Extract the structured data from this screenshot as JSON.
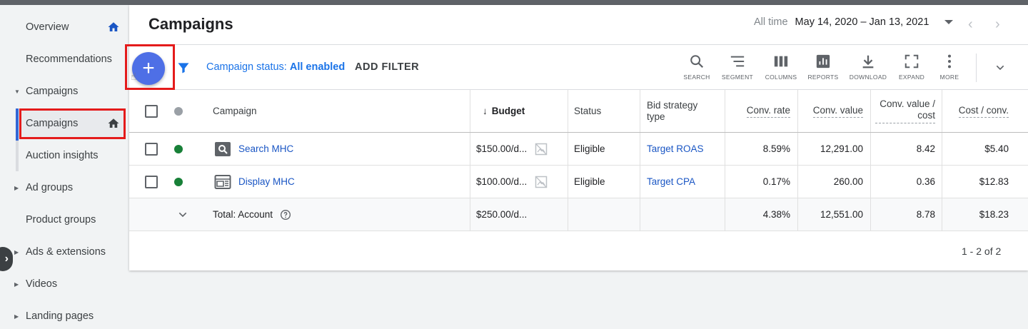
{
  "sidebar": {
    "items": [
      {
        "label": "Overview"
      },
      {
        "label": "Recommendations"
      },
      {
        "label": "Campaigns"
      },
      {
        "label": "Campaigns"
      },
      {
        "label": "Auction insights"
      },
      {
        "label": "Ad groups"
      },
      {
        "label": "Product groups"
      },
      {
        "label": "Ads & extensions"
      },
      {
        "label": "Videos"
      },
      {
        "label": "Landing pages"
      }
    ]
  },
  "header": {
    "title": "Campaigns",
    "date_prefix": "All time",
    "date_range": "May 14, 2020 – Jan 13, 2021"
  },
  "toolbar": {
    "filter_label": "Campaign status:",
    "filter_value": "All enabled",
    "add_filter": "ADD FILTER",
    "tools": [
      "SEARCH",
      "SEGMENT",
      "COLUMNS",
      "REPORTS",
      "DOWNLOAD",
      "EXPAND",
      "MORE"
    ]
  },
  "table": {
    "columns": {
      "campaign": "Campaign",
      "budget": "Budget",
      "status": "Status",
      "bid_strategy": "Bid strategy type",
      "conv_rate": "Conv. rate",
      "conv_value": "Conv. value",
      "conv_value_cost": "Conv. value / cost",
      "cost_conv": "Cost / conv."
    },
    "rows": [
      {
        "campaign": "Search MHC",
        "budget": "$150.00/d...",
        "status": "Eligible",
        "bid_strategy": "Target ROAS",
        "conv_rate": "8.59%",
        "conv_value": "12,291.00",
        "conv_value_cost": "8.42",
        "cost_conv": "$5.40"
      },
      {
        "campaign": "Display MHC",
        "budget": "$100.00/d...",
        "status": "Eligible",
        "bid_strategy": "Target CPA",
        "conv_rate": "0.17%",
        "conv_value": "260.00",
        "conv_value_cost": "0.36",
        "cost_conv": "$12.83"
      }
    ],
    "total": {
      "label": "Total: Account",
      "budget": "$250.00/d...",
      "conv_rate": "4.38%",
      "conv_value": "12,551.00",
      "conv_value_cost": "8.78",
      "cost_conv": "$18.23"
    }
  },
  "pagination": "1 - 2 of 2",
  "colors": {
    "accent": "#4e6fe6",
    "active_nav": "#3367d6",
    "eligible": "#188038",
    "highlight": "#e41b1b"
  }
}
